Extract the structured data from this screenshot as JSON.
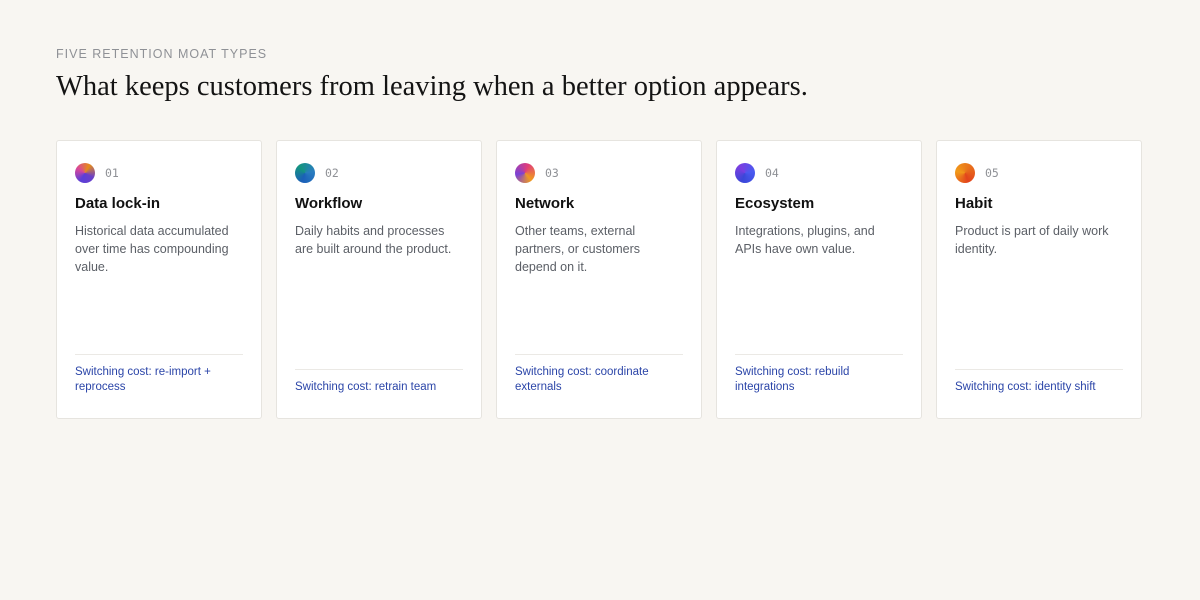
{
  "header": {
    "eyebrow": "FIVE RETENTION MOAT TYPES",
    "headline": "What keeps customers from leaving when a better option appears."
  },
  "colors": {
    "background": "#f8f6f2",
    "card": "#ffffff",
    "link_text": "#2b45a8"
  },
  "cards": [
    {
      "icon": "gradient-dot-icon",
      "number": "01",
      "title": "Data lock-in",
      "description": "Historical data accumulated over time has compounding value.",
      "switching_cost": "Switching cost: re-import + reprocess"
    },
    {
      "icon": "gradient-dot-icon",
      "number": "02",
      "title": "Workflow",
      "description": "Daily habits and processes are built around the product.",
      "switching_cost": "Switching cost: retrain team"
    },
    {
      "icon": "gradient-dot-icon",
      "number": "03",
      "title": "Network",
      "description": "Other teams, external partners, or customers depend on it.",
      "switching_cost": "Switching cost: coordinate externals"
    },
    {
      "icon": "gradient-dot-icon",
      "number": "04",
      "title": "Ecosystem",
      "description": "Integrations, plugins, and APIs have own value.",
      "switching_cost": "Switching cost: rebuild integrations"
    },
    {
      "icon": "gradient-dot-icon",
      "number": "05",
      "title": "Habit",
      "description": "Product is part of daily work identity.",
      "switching_cost": "Switching cost: identity shift"
    }
  ]
}
